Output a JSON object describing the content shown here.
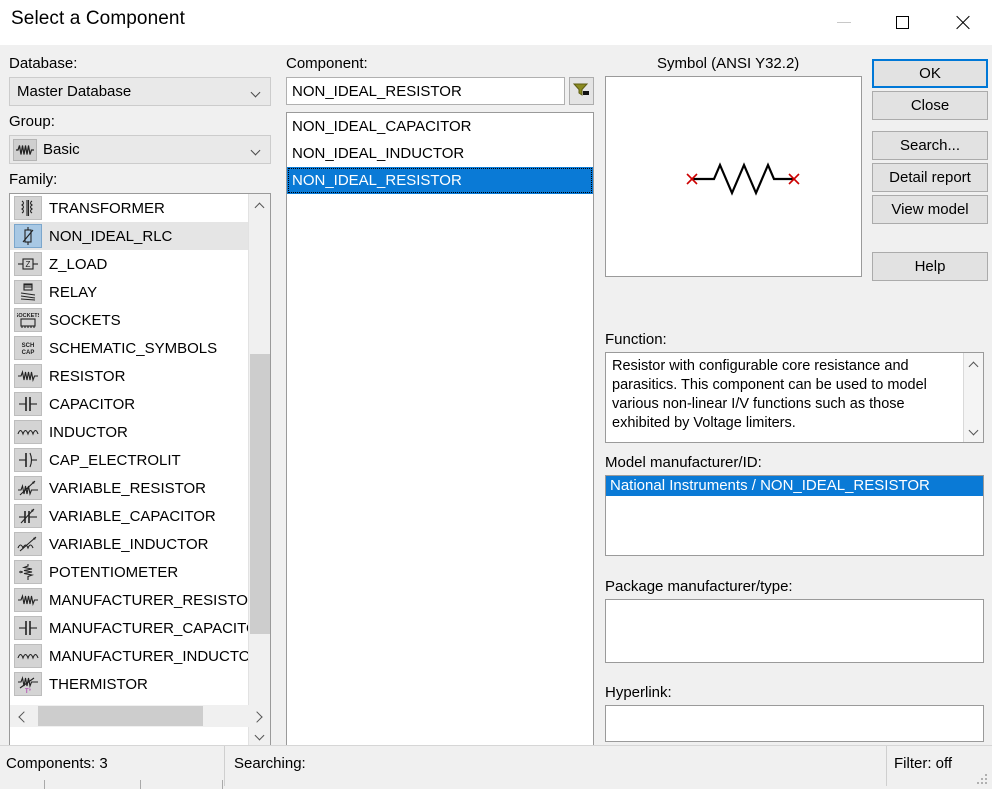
{
  "window": {
    "title": "Select a Component",
    "controls": {
      "minimize": "minimize-icon",
      "maximize": "maximize-icon",
      "close": "close-icon"
    }
  },
  "database": {
    "label": "Database:",
    "value": "Master Database"
  },
  "group": {
    "label": "Group:",
    "value": "Basic",
    "icon": "resistor-icon"
  },
  "family": {
    "label": "Family:",
    "selected": "NON_IDEAL_RLC",
    "items": [
      {
        "label": "TRANSFORMER",
        "icon": "transformer-icon"
      },
      {
        "label": "NON_IDEAL_RLC",
        "icon": "non-ideal-rlc-icon"
      },
      {
        "label": "Z_LOAD",
        "icon": "z-load-icon"
      },
      {
        "label": "RELAY",
        "icon": "relay-icon"
      },
      {
        "label": "SOCKETS",
        "icon": "sockets-icon"
      },
      {
        "label": "SCHEMATIC_SYMBOLS",
        "icon": "schematic-symbols-icon"
      },
      {
        "label": "RESISTOR",
        "icon": "resistor-icon"
      },
      {
        "label": "CAPACITOR",
        "icon": "capacitor-icon"
      },
      {
        "label": "INDUCTOR",
        "icon": "inductor-icon"
      },
      {
        "label": "CAP_ELECTROLIT",
        "icon": "cap-electrolit-icon"
      },
      {
        "label": "VARIABLE_RESISTOR",
        "icon": "variable-resistor-icon"
      },
      {
        "label": "VARIABLE_CAPACITOR",
        "icon": "variable-capacitor-icon"
      },
      {
        "label": "VARIABLE_INDUCTOR",
        "icon": "variable-inductor-icon"
      },
      {
        "label": "POTENTIOMETER",
        "icon": "potentiometer-icon"
      },
      {
        "label": "MANUFACTURER_RESISTOR",
        "icon": "manufacturer-resistor-icon"
      },
      {
        "label": "MANUFACTURER_CAPACITOR",
        "icon": "manufacturer-capacitor-icon"
      },
      {
        "label": "MANUFACTURER_INDUCTOR",
        "icon": "manufacturer-inductor-icon"
      },
      {
        "label": "THERMISTOR",
        "icon": "thermistor-icon"
      }
    ]
  },
  "component": {
    "label": "Component:",
    "search_value": "NON_IDEAL_RESISTOR",
    "filter_icon": "filter-funnel-icon",
    "selected": "NON_IDEAL_RESISTOR",
    "items": [
      "NON_IDEAL_CAPACITOR",
      "NON_IDEAL_INDUCTOR",
      "NON_IDEAL_RESISTOR"
    ]
  },
  "symbol": {
    "label": "Symbol (ANSI Y32.2)",
    "graphic": "resistor-schematic-symbol"
  },
  "buttons": {
    "ok": "OK",
    "close": "Close",
    "search": "Search...",
    "detail_report": "Detail report",
    "view_model": "View model",
    "help": "Help"
  },
  "function": {
    "label": "Function:",
    "text": "Resistor with configurable core resistance and parasitics. This component can be used to model various non-linear I/V functions such as those exhibited by Voltage limiters."
  },
  "model_manufacturer": {
    "label": "Model manufacturer/ID:",
    "selected": "National Instruments / NON_IDEAL_RESISTOR"
  },
  "package_manufacturer": {
    "label": "Package manufacturer/type:",
    "value": ""
  },
  "hyperlink": {
    "label": "Hyperlink:",
    "value": ""
  },
  "statusbar": {
    "components": "Components: 3",
    "searching": "Searching:",
    "filter": "Filter: off"
  },
  "colors": {
    "selection_blue": "#0a7ad6",
    "focus_blue": "#0078d7",
    "dialog_bg": "#f0f0f0",
    "terminal_red": "#cc0000"
  }
}
